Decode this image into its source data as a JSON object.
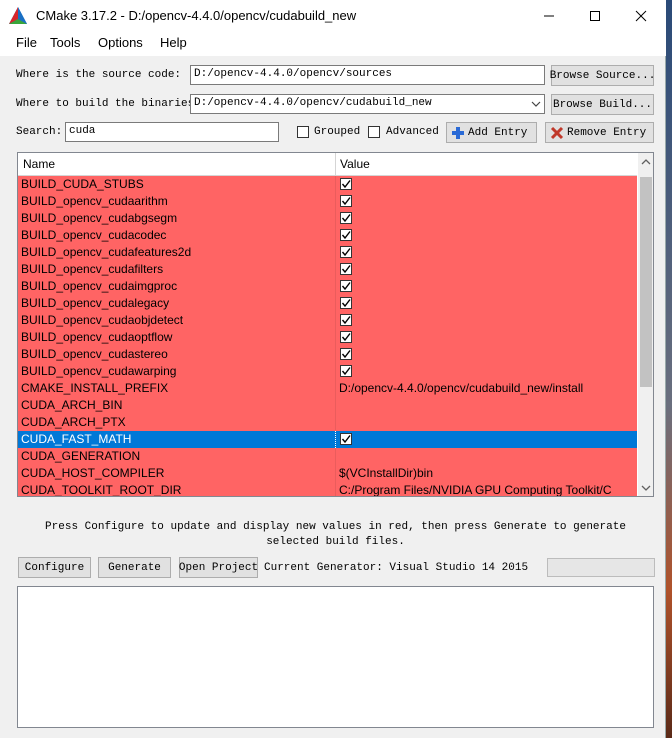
{
  "window": {
    "title": "CMake 3.17.2 - D:/opencv-4.4.0/opencv/cudabuild_new"
  },
  "menu": [
    "File",
    "Tools",
    "Options",
    "Help"
  ],
  "source": {
    "label": "Where is the source code:",
    "value": "D:/opencv-4.4.0/opencv/sources",
    "button": "Browse Source..."
  },
  "build": {
    "label": "Where to build the binaries:",
    "value": "D:/opencv-4.4.0/opencv/cudabuild_new",
    "button": "Browse Build..."
  },
  "search": {
    "label": "Search:",
    "value": "cuda"
  },
  "options": {
    "grouped": "Grouped",
    "advanced": "Advanced",
    "add_entry": "Add Entry",
    "remove_entry": "Remove Entry"
  },
  "table": {
    "columns": [
      "Name",
      "Value"
    ],
    "rows": [
      {
        "name": "BUILD_CUDA_STUBS",
        "checkbox": true,
        "value": ""
      },
      {
        "name": "BUILD_opencv_cudaarithm",
        "checkbox": true,
        "value": ""
      },
      {
        "name": "BUILD_opencv_cudabgsegm",
        "checkbox": true,
        "value": ""
      },
      {
        "name": "BUILD_opencv_cudacodec",
        "checkbox": true,
        "value": ""
      },
      {
        "name": "BUILD_opencv_cudafeatures2d",
        "checkbox": true,
        "value": ""
      },
      {
        "name": "BUILD_opencv_cudafilters",
        "checkbox": true,
        "value": ""
      },
      {
        "name": "BUILD_opencv_cudaimgproc",
        "checkbox": true,
        "value": ""
      },
      {
        "name": "BUILD_opencv_cudalegacy",
        "checkbox": true,
        "value": ""
      },
      {
        "name": "BUILD_opencv_cudaobjdetect",
        "checkbox": true,
        "value": ""
      },
      {
        "name": "BUILD_opencv_cudaoptflow",
        "checkbox": true,
        "value": ""
      },
      {
        "name": "BUILD_opencv_cudastereo",
        "checkbox": true,
        "value": ""
      },
      {
        "name": "BUILD_opencv_cudawarping",
        "checkbox": true,
        "value": ""
      },
      {
        "name": "CMAKE_INSTALL_PREFIX",
        "checkbox": false,
        "value": "D:/opencv-4.4.0/opencv/cudabuild_new/install"
      },
      {
        "name": "CUDA_ARCH_BIN",
        "checkbox": false,
        "value": ""
      },
      {
        "name": "CUDA_ARCH_PTX",
        "checkbox": false,
        "value": ""
      },
      {
        "name": "CUDA_FAST_MATH",
        "checkbox": true,
        "value": "",
        "selected": true
      },
      {
        "name": "CUDA_GENERATION",
        "checkbox": false,
        "value": ""
      },
      {
        "name": "CUDA_HOST_COMPILER",
        "checkbox": false,
        "value": "$(VCInstallDir)bin"
      },
      {
        "name": "CUDA_TOOLKIT_ROOT_DIR",
        "checkbox": false,
        "value": "C:/Program Files/NVIDIA GPU Computing Toolkit/C"
      }
    ]
  },
  "info_text": "Press Configure to update and display new values in red, then press Generate to generate selected build files.",
  "actions": {
    "configure": "Configure",
    "generate": "Generate",
    "open_project": "Open Project",
    "generator": "Current Generator: Visual Studio 14 2015"
  },
  "colors": {
    "changed_row": "#ff6464",
    "selected_row": "#0078d7"
  }
}
